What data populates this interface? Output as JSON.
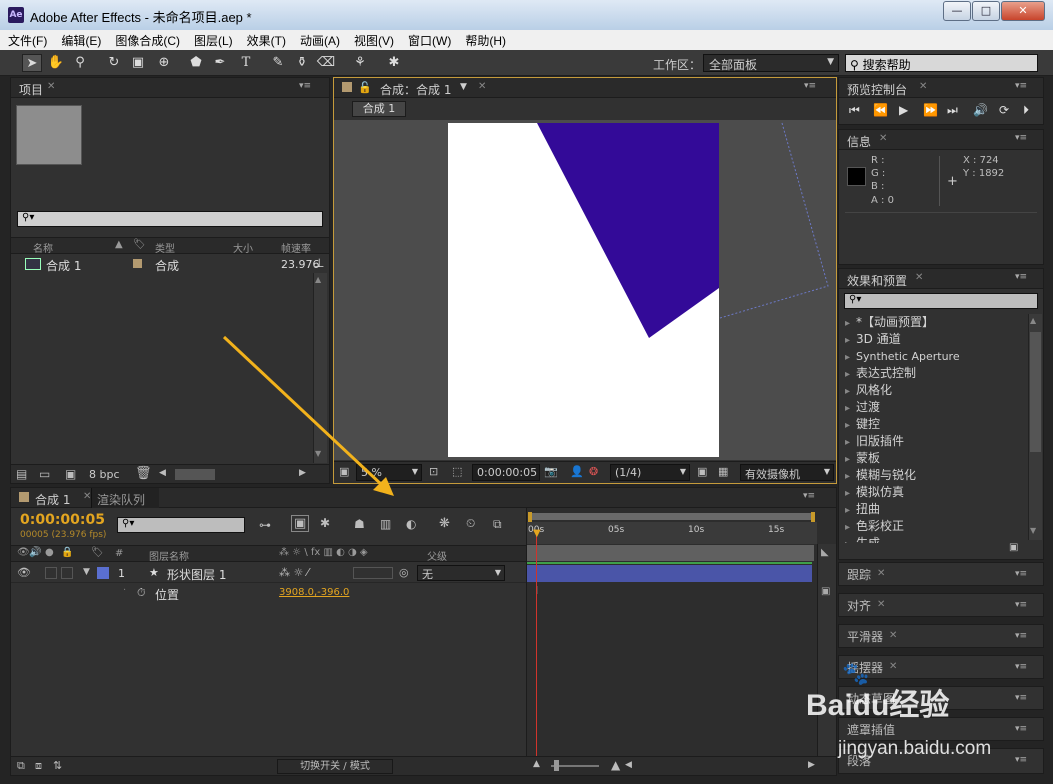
{
  "window": {
    "title": "Adobe After Effects - 未命名项目.aep *",
    "app_icon": "Ae",
    "min": "—",
    "max": "□",
    "close": "✕"
  },
  "menu": [
    "文件(F)",
    "编辑(E)",
    "图像合成(C)",
    "图层(L)",
    "效果(T)",
    "动画(A)",
    "视图(V)",
    "窗口(W)",
    "帮助(H)"
  ],
  "toolbar": {
    "workspace_label": "工作区：",
    "workspace_value": "全部面板",
    "search_help": "搜索帮助"
  },
  "project": {
    "tab": "项目",
    "columns": {
      "name": "名称",
      "type": "类型",
      "size": "大小",
      "fps": "帧速率"
    },
    "items": [
      {
        "name": "合成 1",
        "type": "合成",
        "fps": "23.976"
      }
    ],
    "bpc": "8 bpc"
  },
  "composition": {
    "tab": "合成：合成 1",
    "subtab": "合成 1",
    "zoom": "5 %",
    "timecode": "0:00:00:05",
    "resolution": "(1/4)",
    "camera": "有效摄像机"
  },
  "preview": {
    "tab": "预览控制台"
  },
  "info": {
    "tab": "信息",
    "r": "R :",
    "g": "G :",
    "b": "B :",
    "a": "A : 0",
    "x": "X : 724",
    "y": "Y : 1892"
  },
  "effects": {
    "tab": "效果和预置",
    "items": [
      "*【动画预置】",
      "3D 通道",
      "Synthetic Aperture",
      "表达式控制",
      "风格化",
      "过渡",
      "键控",
      "旧版插件",
      "蒙板",
      "模糊与锐化",
      "模拟仿真",
      "扭曲",
      "色彩校正",
      "生成"
    ]
  },
  "right_panels": [
    "跟踪",
    "对齐",
    "平滑器",
    "摇摆器",
    "动态草图",
    "遮罩插值",
    "段落"
  ],
  "timeline": {
    "tab": "合成 1",
    "render_tab": "渲染队列",
    "timecode": "0:00:00:05",
    "frame_info": "00005 (23.976 fps)",
    "col_num": "#",
    "col_layer_name": "图层名称",
    "col_parent": "父级",
    "layer": {
      "num": "1",
      "name": "形状图层 1",
      "parent": "无"
    },
    "property": {
      "name": "位置",
      "value": "3908.0,-396.0"
    },
    "ruler": [
      "00s",
      "05s",
      "10s",
      "15s"
    ],
    "footer": "切换开关 / 模式"
  },
  "watermark": {
    "brand": "Baidu经验",
    "url": "jingyan.baidu.com"
  },
  "colors": {
    "shape": "#330a98",
    "timecode": "#e3a520",
    "layer_bar": "#4a55a8",
    "accent_arrow": "#f2b21c"
  }
}
